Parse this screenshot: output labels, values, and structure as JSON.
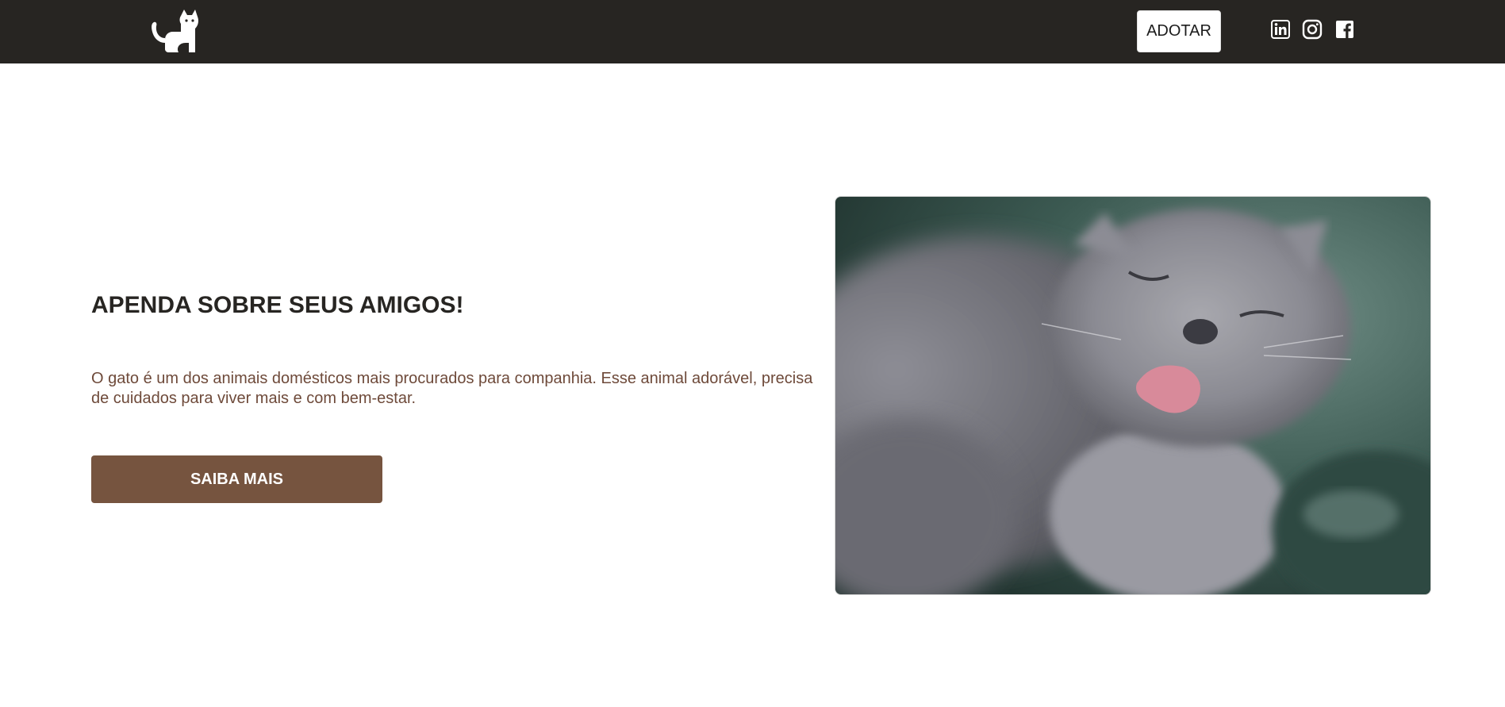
{
  "header": {
    "logo_icon": "cat-icon",
    "adopt_label": "ADOTAR",
    "social": [
      {
        "name": "linkedin",
        "icon": "linkedin-icon"
      },
      {
        "name": "instagram",
        "icon": "instagram-icon"
      },
      {
        "name": "facebook",
        "icon": "facebook-icon"
      }
    ]
  },
  "hero": {
    "title": "APENDA SOBRE SEUS AMIGOS!",
    "text": "O gato é um dos animais domésticos mais procurados para companhia. Esse animal adorável, precisa de cuidados para viver mais e com bem-estar.",
    "button_label": "SAIBA MAIS",
    "image": "gray-cat-photo"
  },
  "colors": {
    "topbar": "#272522",
    "title": "#272522",
    "text": "#6e4a3a",
    "button": "#76543f"
  }
}
